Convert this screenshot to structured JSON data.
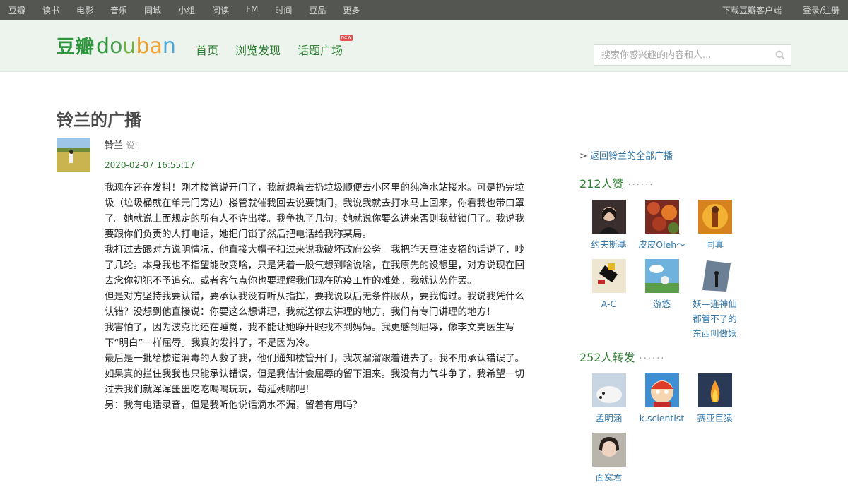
{
  "topbar": {
    "nav": [
      "豆瓣",
      "读书",
      "电影",
      "音乐",
      "同城",
      "小组",
      "阅读",
      "FM",
      "时间",
      "豆品",
      "更多"
    ],
    "right": [
      "下载豆瓣客户端",
      "登录/注册"
    ]
  },
  "header": {
    "logo_zh": "豆瓣",
    "logo_en": "douban",
    "nav": [
      {
        "label": "首页",
        "new": false
      },
      {
        "label": "浏览发现",
        "new": false
      },
      {
        "label": "话题广场",
        "new": true
      }
    ],
    "new_badge": "new",
    "search_placeholder": "搜索你感兴趣的内容和人..."
  },
  "page_title": "铃兰的广播",
  "status": {
    "author": "铃兰",
    "said": "说:",
    "time": "2020-02-07 16:55:17",
    "paragraphs": [
      "我现在还在发抖！刚才楼管说开门了，我就想着去扔垃圾顺便去小区里的纯净水站接水。可是扔完垃圾（垃圾桶就在单元门旁边）楼管就催我回去说要锁门，我说我就去打水马上回来，你看我也带口罩了。她就说上面规定的所有人不许出楼。我争执了几句，她就说你要么进来否则我就锁门了。我说我要跟你们负责的人打电话，她把门锁了然后把电话给我称某局。",
      "我打过去跟对方说明情况，他直接大帽子扣过来说我破坏政府公务。我把昨天豆油支招的话说了，吵了几轮。本身我也不指望能改变啥，只是凭着一股气想到啥说啥，在我原先的设想里，对方说现在回去念你初犯不予追究。或者客气点你也要理解我们现在防疫工作的难处。我就认怂作罢。",
      "但是对方坚持我要认错，要承认我没有听从指挥，要我说以后无条件服从，要我悔过。我说我凭什么认错？没想到他直接说：你要这么想讲理，我就送你去讲理的地方，我们有专门讲理的地方！",
      "我害怕了，因为波克比还在睡觉，我不能让她睁开眼找不到妈妈。我更感到屈辱，像李文亮医生写下“明白”一样屈辱。我真的发抖了，不是因为冷。",
      "最后是一批给楼道消毒的人救了我，他们通知楼管开门，我灰溜溜跟着进去了。我不用承认错误了。如果真的拦住我我也只能承认错误，但是我估计会屈辱的留下泪来。我没有力气斗争了，我希望一切过去我们就浑浑噩噩吃吃喝喝玩玩，苟延残喘吧！",
      "另：我有电话录音，但是我听他说话滴水不漏，留着有用吗？"
    ]
  },
  "sidebar": {
    "back_prefix": ">",
    "back_link": "返回铃兰的全部广播",
    "likes_title": "212人赞",
    "dots": "······",
    "likes": [
      {
        "name": "约夫斯基",
        "icon": "woman-portrait-avatar"
      },
      {
        "name": "皮皮Oleh～",
        "icon": "autumn-leaves-avatar"
      },
      {
        "name": "同真",
        "icon": "golden-statue-avatar"
      },
      {
        "name": "A-C",
        "icon": "geometric-art-avatar"
      },
      {
        "name": "游悠",
        "icon": "sky-cartoon-avatar"
      },
      {
        "name": "妖—连神仙都管不了的东西叫做妖",
        "icon": "silhouette-sky-avatar"
      }
    ],
    "reshares_title": "252人转发",
    "reshares": [
      {
        "name": "孟明涵",
        "icon": "polar-bear-avatar"
      },
      {
        "name": "k.scientist",
        "icon": "cartoon-boy-avatar"
      },
      {
        "name": "赛亚巨猿",
        "icon": "campfire-avatar"
      },
      {
        "name": "面窝君",
        "icon": "girl-photo-avatar"
      }
    ]
  }
}
